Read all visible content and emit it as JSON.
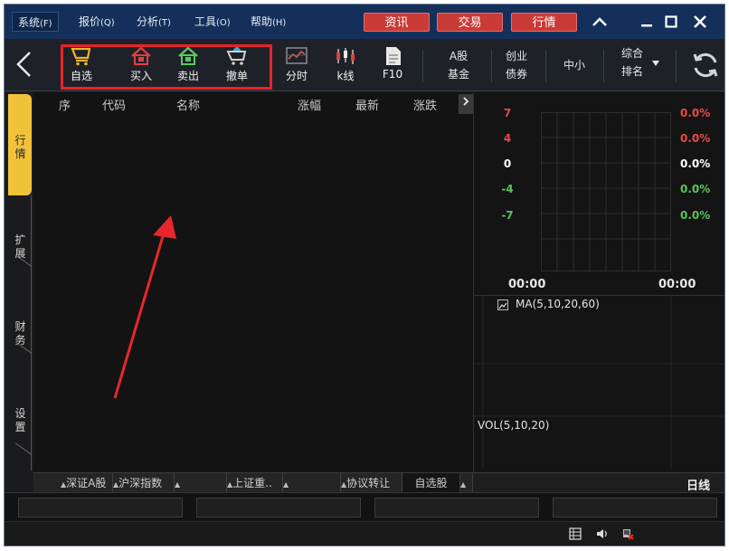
{
  "menu": [
    {
      "label": "系统",
      "key": "(F)"
    },
    {
      "label": "报价",
      "key": "(Q)"
    },
    {
      "label": "分析",
      "key": "(T)"
    },
    {
      "label": "工具",
      "key": "(O)"
    },
    {
      "label": "帮助",
      "key": "(H)"
    }
  ],
  "header_buttons": {
    "news": "资讯",
    "trade": "交易",
    "quotes": "行情"
  },
  "toolbar": {
    "watchlist": "自选",
    "buy": "买入",
    "sell": "卖出",
    "cancel": "撤单",
    "timeshare": "分时",
    "kline": "k线",
    "f10": "F10",
    "ashare": "A股",
    "fund": "基金",
    "chinext": "创业",
    "bond": "债券",
    "smb": "中小",
    "rank_line1": "综合",
    "rank_line2": "排名"
  },
  "side_tabs": [
    "行情",
    "扩展",
    "财务",
    "设置"
  ],
  "list_columns": [
    "序",
    "代码",
    "名称",
    "涨幅",
    "最新",
    "涨跌"
  ],
  "chart": {
    "y_left": [
      "7",
      "4",
      "0",
      "-4",
      "-7"
    ],
    "y_right": [
      "0.0%",
      "0.0%",
      "0.0%",
      "0.0%",
      "0.0%"
    ],
    "time_start": "00:00",
    "time_end": "00:00",
    "ma_label": "MA(5,10,20,60)",
    "vol_label": "VOL(5,10,20)",
    "period": "日线"
  },
  "market_tabs": [
    "深证A股",
    "沪深指数",
    "",
    "上证重..",
    "",
    "协议转让",
    "自选股"
  ],
  "colors": {
    "accent_red": "#c93b37",
    "tab_active": "#f0c23a",
    "up": "#e84a4a",
    "down": "#5cc25c",
    "titlebar": "#14305a"
  }
}
